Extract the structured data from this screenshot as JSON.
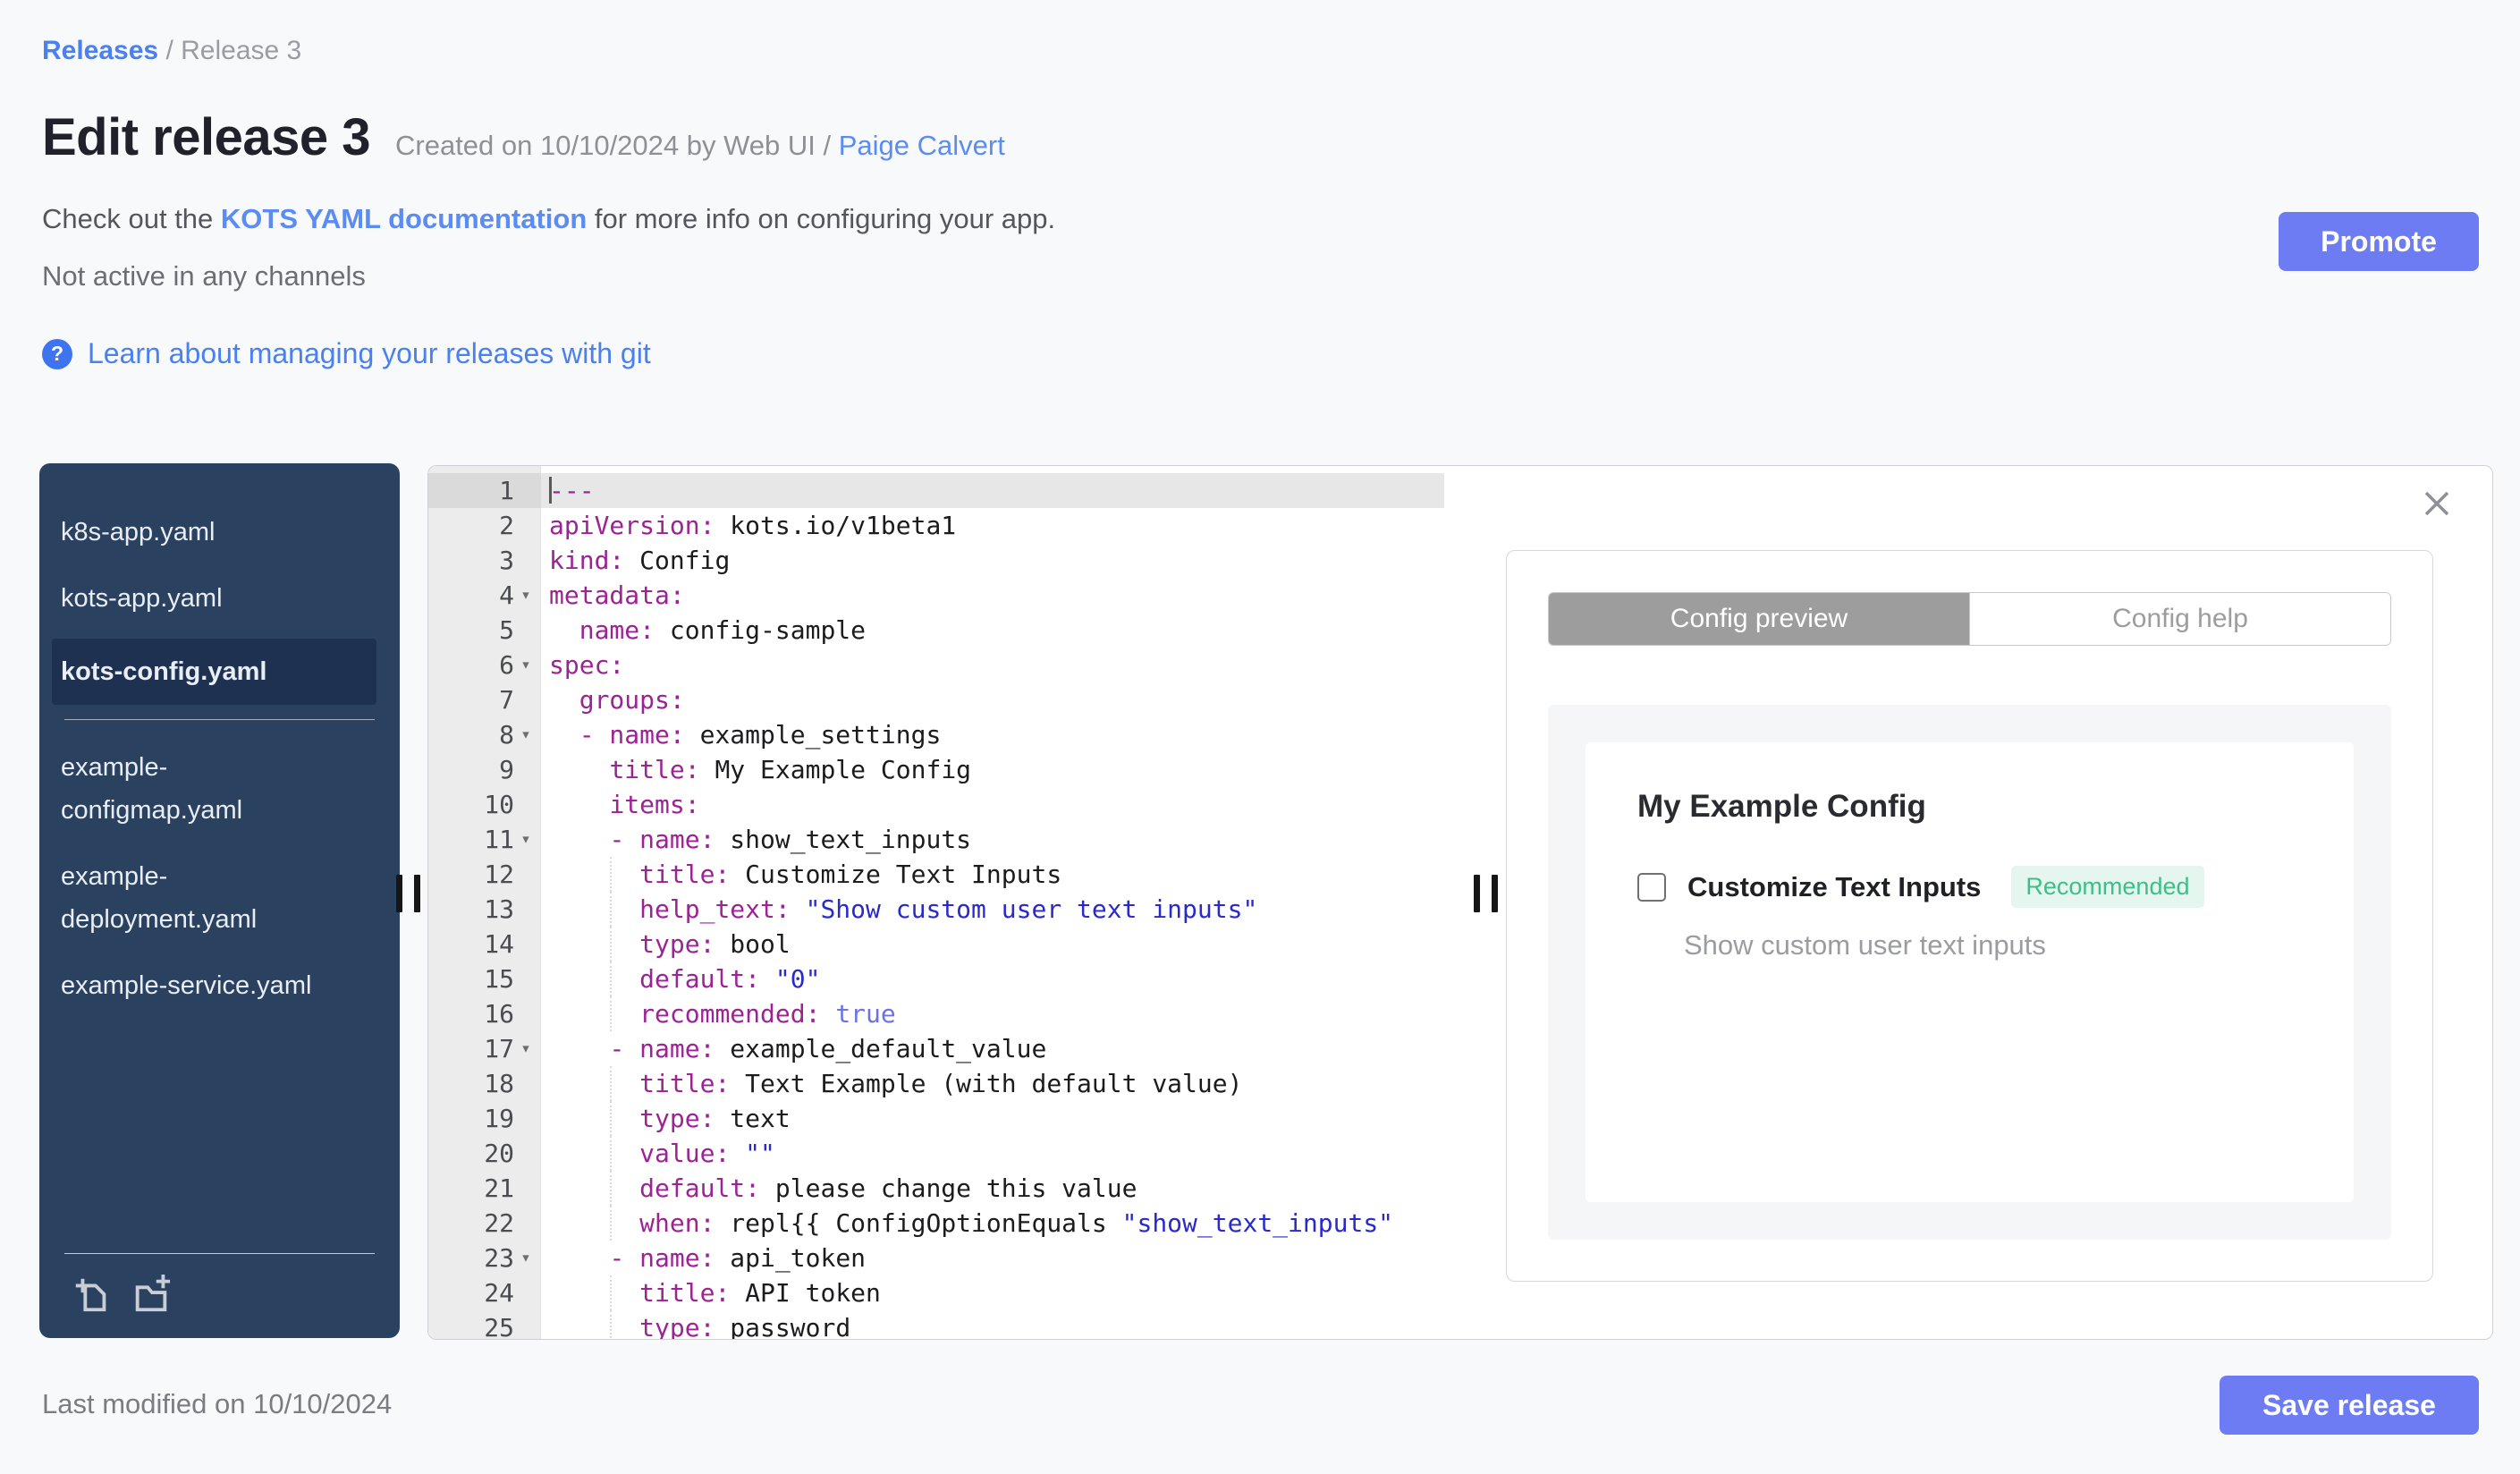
{
  "header": {
    "breadcrumb": {
      "releases": "Releases",
      "separator": " / ",
      "current": "Release 3"
    },
    "title": "Edit release 3",
    "created": {
      "prefix": "Created on 10/10/2024 by Web UI / ",
      "author": "Paige Calvert"
    },
    "doc_note": {
      "prefix": "Check out the ",
      "link": "KOTS YAML documentation",
      "suffix": " for more info on configuring your app."
    },
    "channel_status": "Not active in any channels",
    "git_help": {
      "icon_glyph": "?",
      "label": "Learn about managing your releases with git"
    },
    "promote_label": "Promote"
  },
  "sidebar": {
    "files": [
      {
        "name": "k8s-app.yaml",
        "selected": false,
        "section": 1
      },
      {
        "name": "kots-app.yaml",
        "selected": false,
        "section": 1
      },
      {
        "name": "kots-config.yaml",
        "selected": true,
        "section": 1
      },
      {
        "name": "example-configmap.yaml",
        "selected": false,
        "section": 2
      },
      {
        "name": "example-deployment.yaml",
        "selected": false,
        "section": 2
      },
      {
        "name": "example-service.yaml",
        "selected": false,
        "section": 2
      }
    ],
    "actions": [
      {
        "name": "new-file"
      },
      {
        "name": "new-folder"
      }
    ]
  },
  "editor": {
    "file": "kots-config.yaml",
    "active_line": 1,
    "lines": [
      {
        "active": true,
        "cursor": true,
        "tokens": [
          [
            "k",
            "---"
          ]
        ]
      },
      {
        "tokens": [
          [
            "k",
            "apiVersion:"
          ],
          [
            "p",
            " kots.io/v1beta1"
          ]
        ]
      },
      {
        "tokens": [
          [
            "k",
            "kind:"
          ],
          [
            "p",
            " Config"
          ]
        ]
      },
      {
        "fold": true,
        "tokens": [
          [
            "k",
            "metadata:"
          ]
        ]
      },
      {
        "tokens": [
          [
            "p",
            "  "
          ],
          [
            "k",
            "name:"
          ],
          [
            "p",
            " config-sample"
          ]
        ]
      },
      {
        "fold": true,
        "tokens": [
          [
            "k",
            "spec:"
          ]
        ]
      },
      {
        "tokens": [
          [
            "p",
            "  "
          ],
          [
            "k",
            "groups:"
          ]
        ]
      },
      {
        "fold": true,
        "tokens": [
          [
            "p",
            "  "
          ],
          [
            "k",
            "- name:"
          ],
          [
            "p",
            " example_settings"
          ]
        ]
      },
      {
        "tokens": [
          [
            "p",
            "    "
          ],
          [
            "k",
            "title:"
          ],
          [
            "p",
            " My Example Config"
          ]
        ]
      },
      {
        "tokens": [
          [
            "p",
            "    "
          ],
          [
            "k",
            "items:"
          ]
        ]
      },
      {
        "fold": true,
        "tokens": [
          [
            "p",
            "    "
          ],
          [
            "k",
            "- name:"
          ],
          [
            "p",
            " show_text_inputs"
          ]
        ]
      },
      {
        "guide": true,
        "tokens": [
          [
            "p",
            "      "
          ],
          [
            "k",
            "title:"
          ],
          [
            "p",
            " Customize Text Inputs"
          ]
        ]
      },
      {
        "guide": true,
        "tokens": [
          [
            "p",
            "      "
          ],
          [
            "k",
            "help_text:"
          ],
          [
            "p",
            " "
          ],
          [
            "s",
            "\"Show custom user text inputs\""
          ]
        ]
      },
      {
        "guide": true,
        "tokens": [
          [
            "p",
            "      "
          ],
          [
            "k",
            "type:"
          ],
          [
            "p",
            " bool"
          ]
        ]
      },
      {
        "guide": true,
        "tokens": [
          [
            "p",
            "      "
          ],
          [
            "k",
            "default:"
          ],
          [
            "p",
            " "
          ],
          [
            "s",
            "\"0\""
          ]
        ]
      },
      {
        "guide": true,
        "tokens": [
          [
            "p",
            "      "
          ],
          [
            "k",
            "recommended:"
          ],
          [
            "p",
            " "
          ],
          [
            "b",
            "true"
          ]
        ]
      },
      {
        "fold": true,
        "tokens": [
          [
            "p",
            "    "
          ],
          [
            "k",
            "- name:"
          ],
          [
            "p",
            " example_default_value"
          ]
        ]
      },
      {
        "guide": true,
        "tokens": [
          [
            "p",
            "      "
          ],
          [
            "k",
            "title:"
          ],
          [
            "p",
            " Text Example (with default value)"
          ]
        ]
      },
      {
        "guide": true,
        "tokens": [
          [
            "p",
            "      "
          ],
          [
            "k",
            "type:"
          ],
          [
            "p",
            " text"
          ]
        ]
      },
      {
        "guide": true,
        "tokens": [
          [
            "p",
            "      "
          ],
          [
            "k",
            "value:"
          ],
          [
            "p",
            " "
          ],
          [
            "s",
            "\"\""
          ]
        ]
      },
      {
        "guide": true,
        "tokens": [
          [
            "p",
            "      "
          ],
          [
            "k",
            "default:"
          ],
          [
            "p",
            " please change this value"
          ]
        ]
      },
      {
        "guide": true,
        "tokens": [
          [
            "p",
            "      "
          ],
          [
            "k",
            "when:"
          ],
          [
            "p",
            " repl{{ ConfigOptionEquals "
          ],
          [
            "s",
            "\"show_text_inputs\""
          ]
        ]
      },
      {
        "fold": true,
        "tokens": [
          [
            "p",
            "    "
          ],
          [
            "k",
            "- name:"
          ],
          [
            "p",
            " api_token"
          ]
        ]
      },
      {
        "guide": true,
        "tokens": [
          [
            "p",
            "      "
          ],
          [
            "k",
            "title:"
          ],
          [
            "p",
            " API token"
          ]
        ]
      },
      {
        "guide": true,
        "tokens": [
          [
            "p",
            "      "
          ],
          [
            "k",
            "type:"
          ],
          [
            "p",
            " password"
          ]
        ]
      }
    ]
  },
  "preview": {
    "tabs": [
      {
        "label": "Config preview",
        "active": true
      },
      {
        "label": "Config help",
        "active": false
      }
    ],
    "group_title": "My Example Config",
    "item": {
      "label": "Customize Text Inputs",
      "badge": "Recommended",
      "help": "Show custom user text inputs",
      "checked": false
    }
  },
  "footer": {
    "last_modified": "Last modified on 10/10/2024",
    "save_label": "Save release"
  },
  "colors": {
    "accent_button": "#6e7cf4",
    "link_blue": "#4a80f0",
    "sidebar_bg": "#2b4160",
    "sidebar_selected_bg": "#1e3150",
    "badge_bg": "#e4f6ed",
    "badge_text": "#3fbd8c",
    "code_key": "#9c2393",
    "code_string": "#2929cc",
    "code_bool": "#6b71e8",
    "active_line_bg": "#e7e7e7"
  }
}
